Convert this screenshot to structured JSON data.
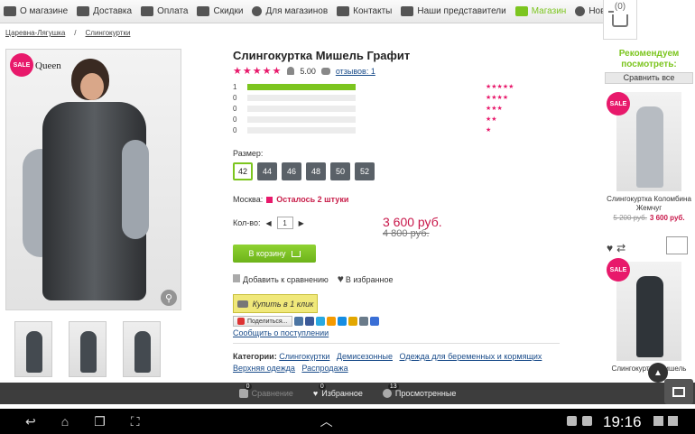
{
  "nav": {
    "items": [
      {
        "label": "О магазине",
        "icon": "home-icon"
      },
      {
        "label": "Доставка",
        "icon": "truck-icon"
      },
      {
        "label": "Оплата",
        "icon": "money-icon"
      },
      {
        "label": "Скидки",
        "icon": "cart-discount-icon"
      },
      {
        "label": "Для магазинов",
        "icon": "chat-icon"
      },
      {
        "label": "Контакты",
        "icon": "mail-icon"
      },
      {
        "label": "Наши представители",
        "icon": "people-icon"
      },
      {
        "label": "Магазин",
        "icon": "shop-icon",
        "active": true
      },
      {
        "label": "Новости",
        "icon": "news-icon"
      }
    ],
    "cart_count": "(0)"
  },
  "breadcrumb": [
    "Царевна-Лягушка",
    "Слингокуртки"
  ],
  "product": {
    "title": "Слингокуртка Мишель Графит",
    "sale": "SALE",
    "brand": "Queen",
    "rating_value": "5.00",
    "reviews_label": "отзывов: 1",
    "rating_bars": [
      {
        "count": "1",
        "fill": 1.0,
        "stars": "★★★★★"
      },
      {
        "count": "0",
        "fill": 0,
        "stars": "★★★★"
      },
      {
        "count": "0",
        "fill": 0,
        "stars": "★★★"
      },
      {
        "count": "0",
        "fill": 0,
        "stars": "★★"
      },
      {
        "count": "0",
        "fill": 0,
        "stars": "★"
      }
    ],
    "size_label": "Размер:",
    "sizes": [
      "42",
      "44",
      "46",
      "48",
      "50",
      "52"
    ],
    "selected_size": "42",
    "stock_city": "Москва:",
    "stock_text": "Осталось 2 штуки",
    "qty_label": "Кол-во:",
    "qty_value": "1",
    "price": "3 600 руб.",
    "old_price": "4 800 руб.",
    "add_to_cart": "В корзину",
    "compare": "Добавить к сравнению",
    "favorite": "В избранное",
    "one_click": "Купить в 1 клик",
    "share_label": "Поделиться...",
    "notify": "Сообщить о поступлении",
    "categories_label": "Категории:",
    "categories": [
      "Слингокуртки",
      "Демисезонные",
      "Одежда для беременных и кормящих",
      "Верхняя одежда",
      "Распродажа"
    ]
  },
  "recommend": {
    "title": "Рекомендуем посмотреть:",
    "compare_all": "Сравнить все",
    "items": [
      {
        "name": "Слингокуртка Коломбина Жемчуг",
        "old_price": "5 200 руб.",
        "price": "3 600 руб.",
        "sale": "SALE"
      },
      {
        "name": "Слингокуртка Мишель",
        "sale": "SALE"
      }
    ]
  },
  "bottom_bar": [
    {
      "label": "Сравнение",
      "count": "0",
      "dim": true
    },
    {
      "label": "Избранное",
      "count": "0"
    },
    {
      "label": "Просмотренные",
      "count": "13"
    }
  ],
  "system": {
    "time": "19:16"
  },
  "colors": {
    "accent": "#7cc51f",
    "sale": "#e8196b",
    "price": "#c8174a"
  }
}
